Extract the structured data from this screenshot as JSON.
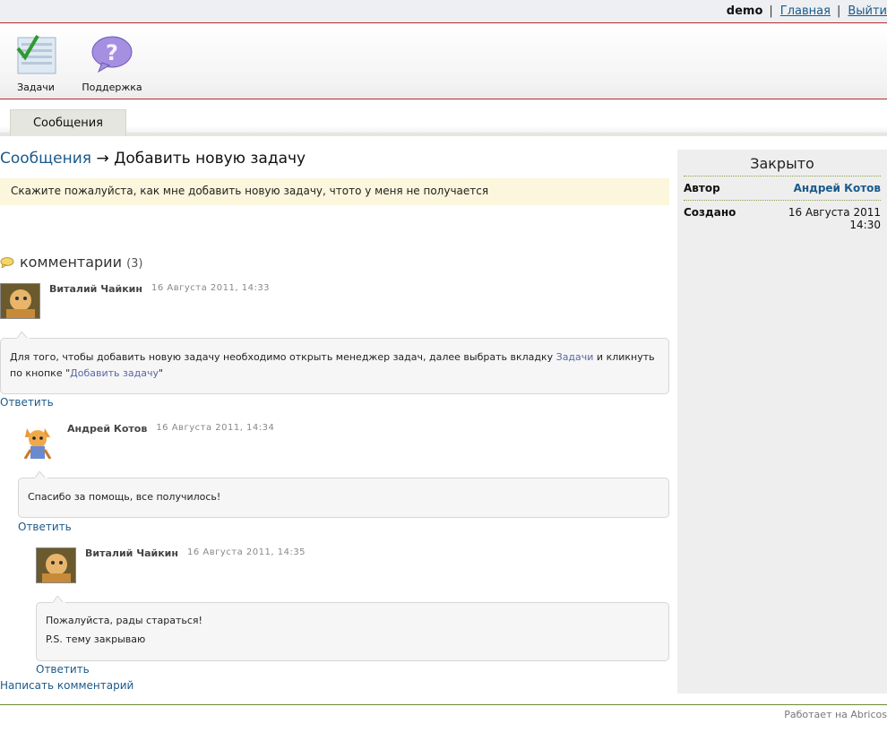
{
  "topbar": {
    "user": "demo",
    "home_link": "Главная",
    "logout_link": "Выйти"
  },
  "apps": [
    {
      "label": "Задачи",
      "icon": "tasks-icon"
    },
    {
      "label": "Поддержка",
      "icon": "support-icon"
    }
  ],
  "tabs": [
    {
      "label": "Сообщения"
    }
  ],
  "breadcrumb": {
    "parent": "Сообщения",
    "arrow": "→",
    "current": "Добавить новую задачу"
  },
  "message": {
    "text": "Скажите пожалуйста, как мне добавить новую задачу, чтото у меня не получается"
  },
  "comments_header": {
    "label": "комментарии",
    "count": "(3)"
  },
  "comments": [
    {
      "author": "Виталий Чайкин",
      "date": "16 Августа 2011, 14:33",
      "text_part1": "Для того, чтобы добавить новую задачу необходимо открыть менеджер задач, далее выбрать вкладку ",
      "link1": "Задачи",
      "text_part2": " и кликнуть по кнопке \"",
      "link2": "Добавить задачу",
      "text_part3": "\"",
      "reply": "Ответить"
    },
    {
      "author": "Андрей Котов",
      "date": "16 Августа 2011, 14:34",
      "text": "Спасибо за помощь, все получилось!",
      "reply": "Ответить"
    },
    {
      "author": "Виталий Чайкин",
      "date": "16 Августа 2011, 14:35",
      "line1": "Пожалуйста, рады стараться!",
      "line2": "P.S. тему закрываю",
      "reply": "Ответить"
    }
  ],
  "write_comment": "Написать комментарий",
  "sidebar": {
    "status": "Закрыто",
    "author_label": "Автор",
    "author_value": "Андрей Котов",
    "created_label": "Создано",
    "created_date": "16 Августа 2011",
    "created_time": "14:30"
  },
  "footer": "Работает на Abricos",
  "colors": {
    "accent_red": "#b22c2c",
    "link_blue": "#1a5a8a",
    "message_bg": "#fbf6dc",
    "sidebar_bg": "#eeeeee"
  }
}
